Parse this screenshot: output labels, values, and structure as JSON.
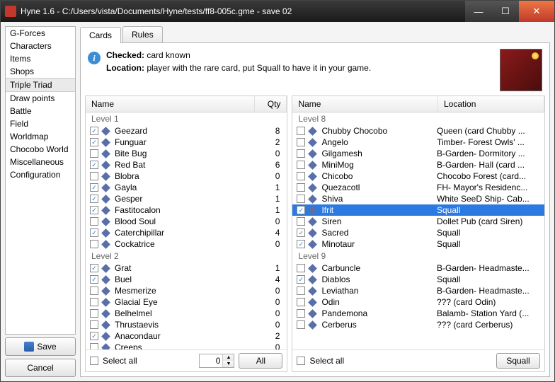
{
  "title": "Hyne 1.6 - C:/Users/vista/Documents/Hyne/tests/ff8-005c.gme - save 02",
  "nav": [
    "G-Forces",
    "Characters",
    "Items",
    "Shops",
    "Triple Triad",
    "Draw points",
    "Battle",
    "Field",
    "Worldmap",
    "Chocobo World",
    "Miscellaneous",
    "Configuration"
  ],
  "nav_selected": 4,
  "buttons": {
    "save": "Save",
    "cancel": "Cancel",
    "all": "All",
    "squall": "Squall"
  },
  "tabs": [
    "Cards",
    "Rules"
  ],
  "active_tab": 0,
  "info": {
    "checked_label": "Checked:",
    "checked_text": "card known",
    "location_label": "Location:",
    "location_text": "player with the rare card, put Squall to have it in your game."
  },
  "left": {
    "cols": {
      "name": "Name",
      "qty": "Qty"
    },
    "groups": [
      {
        "label": "Level 1",
        "rows": [
          {
            "c": true,
            "n": "Geezard",
            "q": 8
          },
          {
            "c": true,
            "n": "Funguar",
            "q": 2
          },
          {
            "c": false,
            "n": "Bite Bug",
            "q": 0
          },
          {
            "c": true,
            "n": "Red Bat",
            "q": 6
          },
          {
            "c": false,
            "n": "Blobra",
            "q": 0
          },
          {
            "c": true,
            "n": "Gayla",
            "q": 1
          },
          {
            "c": true,
            "n": "Gesper",
            "q": 1
          },
          {
            "c": true,
            "n": "Fastitocalon",
            "q": 1
          },
          {
            "c": false,
            "n": "Blood Soul",
            "q": 0
          },
          {
            "c": true,
            "n": "Caterchipillar",
            "q": 4
          },
          {
            "c": false,
            "n": "Cockatrice",
            "q": 0
          }
        ]
      },
      {
        "label": "Level 2",
        "rows": [
          {
            "c": true,
            "n": "Grat",
            "q": 1
          },
          {
            "c": true,
            "n": "Buel",
            "q": 4
          },
          {
            "c": false,
            "n": "Mesmerize",
            "q": 0
          },
          {
            "c": false,
            "n": "Glacial Eye",
            "q": 0
          },
          {
            "c": false,
            "n": "Belhelmel",
            "q": 0
          },
          {
            "c": false,
            "n": "Thrustaevis",
            "q": 0
          },
          {
            "c": true,
            "n": "Anacondaur",
            "q": 2
          },
          {
            "c": false,
            "n": "Creeps",
            "q": 0
          }
        ]
      }
    ],
    "select_all": "Select all",
    "spin_value": "0"
  },
  "right": {
    "cols": {
      "name": "Name",
      "loc": "Location"
    },
    "groups": [
      {
        "label": "Level 8",
        "rows": [
          {
            "c": false,
            "n": "Chubby Chocobo",
            "l": "Queen (card Chubby ..."
          },
          {
            "c": false,
            "n": "Angelo",
            "l": "Timber- Forest Owls' ..."
          },
          {
            "c": false,
            "n": "Gilgamesh",
            "l": "B-Garden- Dormitory ..."
          },
          {
            "c": false,
            "n": "MiniMog",
            "l": "B-Garden- Hall (card ..."
          },
          {
            "c": false,
            "n": "Chicobo",
            "l": "Chocobo Forest (card..."
          },
          {
            "c": false,
            "n": "Quezacotl",
            "l": "FH- Mayor's Residenc..."
          },
          {
            "c": false,
            "n": "Shiva",
            "l": "White SeeD Ship- Cab..."
          },
          {
            "c": true,
            "n": "Ifrit",
            "l": "Squall",
            "sel": true
          },
          {
            "c": false,
            "n": "Siren",
            "l": "Dollet Pub (card Siren)"
          },
          {
            "c": true,
            "n": "Sacred",
            "l": "Squall"
          },
          {
            "c": true,
            "n": "Minotaur",
            "l": "Squall"
          }
        ]
      },
      {
        "label": "Level 9",
        "rows": [
          {
            "c": false,
            "n": "Carbuncle",
            "l": "B-Garden- Headmaste..."
          },
          {
            "c": true,
            "n": "Diablos",
            "l": "Squall"
          },
          {
            "c": false,
            "n": "Leviathan",
            "l": "B-Garden- Headmaste..."
          },
          {
            "c": false,
            "n": "Odin",
            "l": "??? (card Odin)"
          },
          {
            "c": false,
            "n": "Pandemona",
            "l": "Balamb- Station Yard (..."
          },
          {
            "c": false,
            "n": "Cerberus",
            "l": "??? (card Cerberus)"
          }
        ]
      }
    ],
    "select_all": "Select all"
  }
}
